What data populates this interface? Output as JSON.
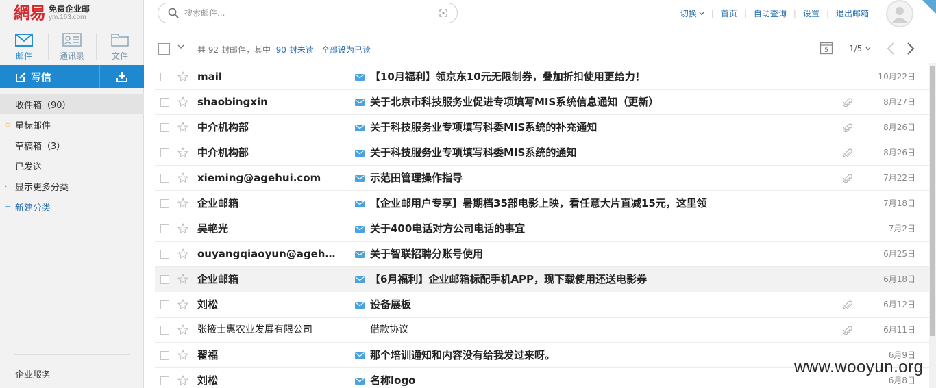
{
  "logo": {
    "mark": "網易",
    "title": "免费企业邮",
    "domain": "ym.163.com"
  },
  "nav_tabs": [
    {
      "label": "邮件",
      "icon": "mail-icon",
      "active": true
    },
    {
      "label": "通讯录",
      "icon": "contacts-icon",
      "active": false
    },
    {
      "label": "文件",
      "icon": "folder-icon",
      "active": false
    }
  ],
  "compose": {
    "label": "写信"
  },
  "folders": {
    "inbox": "收件箱（90）",
    "starred": "星标邮件",
    "drafts": "草稿箱（3）",
    "sent": "已发送",
    "more": "显示更多分类",
    "new_category": "新建分类"
  },
  "sidebar_footer": "企业服务",
  "search": {
    "placeholder": "搜索邮件..."
  },
  "top_links": {
    "switch": "切换",
    "home": "首页",
    "self_service": "自助查询",
    "settings": "设置",
    "logout": "退出邮箱"
  },
  "toolbar": {
    "count_prefix": "共",
    "total": "92",
    "count_mid": "封邮件，其中",
    "unread": "90 封未读",
    "mark_all_read": "全部设为已读",
    "calendar_day": "5",
    "page": "1/5"
  },
  "emails": [
    {
      "from": "mail",
      "subject": "【10月福利】领京东10元无限制券，叠加折扣使用更给力！",
      "date": "10月22日",
      "unread": true,
      "attachment": false
    },
    {
      "from": "shaobingxin",
      "subject": "关于北京市科技服务业促进专项填写MIS系统信息通知（更新）",
      "date": "8月27日",
      "unread": true,
      "attachment": true
    },
    {
      "from": "中介机构部",
      "subject": "关于科技服务业专项填写科委MIS系统的补充通知",
      "date": "8月26日",
      "unread": true,
      "attachment": true
    },
    {
      "from": "中介机构部",
      "subject": "关于科技服务业专项填写科委MIS系统的通知",
      "date": "8月26日",
      "unread": true,
      "attachment": true
    },
    {
      "from": "xieming@agehui.com",
      "subject": "示范田管理操作指导",
      "date": "7月22日",
      "unread": true,
      "attachment": true
    },
    {
      "from": "企业邮箱",
      "subject": "【企业邮用户专享】暑期档35部电影上映，看任意大片直减15元，这里领",
      "date": "7月18日",
      "unread": true,
      "attachment": false
    },
    {
      "from": "吴艳光",
      "subject": "关于400电话对方公司电话的事宜",
      "date": "7月2日",
      "unread": true,
      "attachment": false
    },
    {
      "from": "ouyangqiaoyun@agehui.com",
      "subject": "关于智联招聘分账号使用",
      "date": "6月25日",
      "unread": true,
      "attachment": false
    },
    {
      "from": "企业邮箱",
      "subject": "【6月福利】企业邮箱标配手机APP，现下载使用还送电影券",
      "date": "6月18日",
      "unread": true,
      "attachment": false,
      "highlight": true
    },
    {
      "from": "刘松",
      "subject": "设备展板",
      "date": "6月12日",
      "unread": true,
      "attachment": true
    },
    {
      "from": "张掖士惠农业发展有限公司",
      "subject": "借款协议",
      "date": "6月11日",
      "unread": false,
      "attachment": true
    },
    {
      "from": "翟福",
      "subject": "那个培训通知和内容没有给我发过来呀。",
      "date": "6月9日",
      "unread": true,
      "attachment": false
    },
    {
      "from": "刘松",
      "subject": "名称logo",
      "date": "6月8日",
      "unread": true,
      "attachment": false
    }
  ],
  "watermark": "www.wooyun.org",
  "colors": {
    "accent": "#1e89d0",
    "link": "#2a6fb0",
    "logo_red": "#d6282b",
    "unread_icon": "#4aa3dd"
  }
}
